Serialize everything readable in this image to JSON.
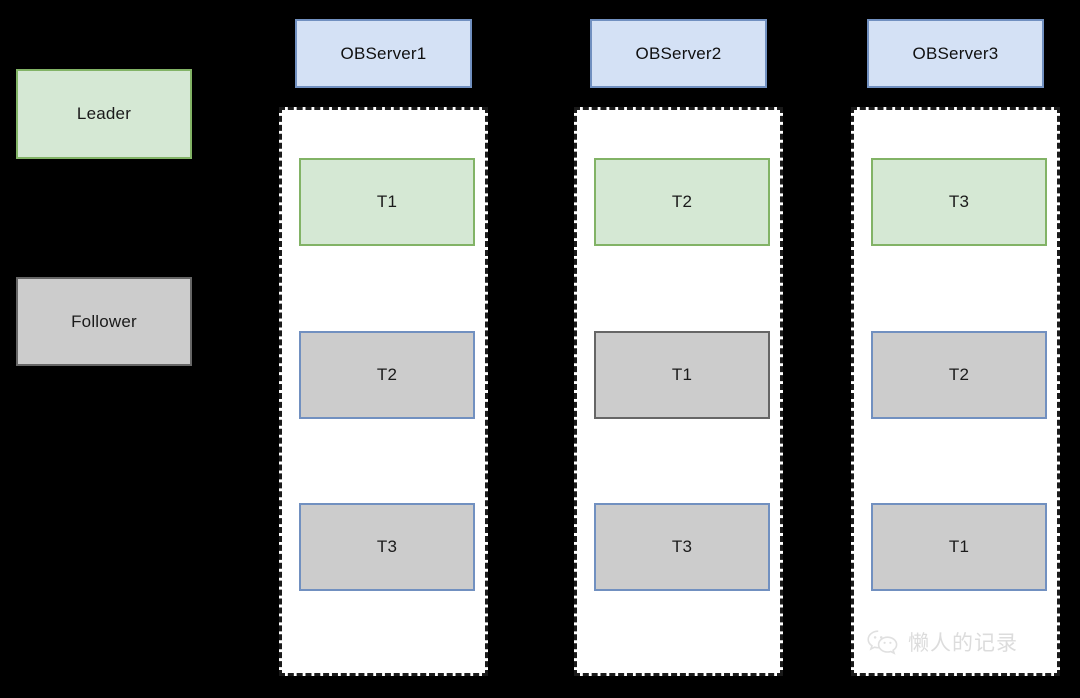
{
  "legend": {
    "leader_label": "Leader",
    "follower_label": "Follower",
    "leader_fill": "#d5e8d4",
    "leader_border": "#82b366",
    "follower_fill": "#cccccc",
    "follower_border": "#666666"
  },
  "servers": [
    {
      "name": "OBServer1",
      "tablets": [
        {
          "label": "T1",
          "role": "leader",
          "fill": "#d5e8d4",
          "border": "#82b366"
        },
        {
          "label": "T2",
          "role": "follower",
          "fill": "#cccccc",
          "border": "#7190c0"
        },
        {
          "label": "T3",
          "role": "follower",
          "fill": "#cccccc",
          "border": "#7190c0"
        }
      ]
    },
    {
      "name": "OBServer2",
      "tablets": [
        {
          "label": "T2",
          "role": "leader",
          "fill": "#d5e8d4",
          "border": "#82b366"
        },
        {
          "label": "T1",
          "role": "follower",
          "fill": "#cccccc",
          "border": "#666666"
        },
        {
          "label": "T3",
          "role": "follower",
          "fill": "#cccccc",
          "border": "#7190c0"
        }
      ]
    },
    {
      "name": "OBServer3",
      "tablets": [
        {
          "label": "T3",
          "role": "leader",
          "fill": "#d5e8d4",
          "border": "#82b366"
        },
        {
          "label": "T2",
          "role": "follower",
          "fill": "#cccccc",
          "border": "#7190c0"
        },
        {
          "label": "T1",
          "role": "follower",
          "fill": "#cccccc",
          "border": "#7190c0"
        }
      ]
    }
  ],
  "watermark": {
    "text": "懒人的记录",
    "icon": "wechat-icon",
    "color": "#8d8d8d"
  },
  "header_fill": "#d4e1f5",
  "header_border": "#7190c0",
  "background": "#000000",
  "server_left_offsets": [
    279,
    574,
    851
  ]
}
